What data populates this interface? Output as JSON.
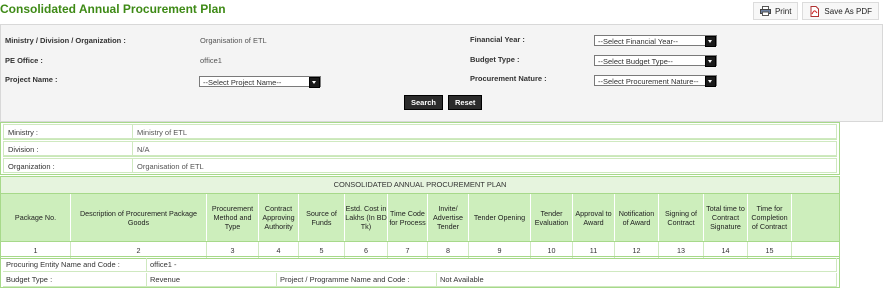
{
  "page": {
    "title": "Consolidated Annual Procurement Plan"
  },
  "actions": {
    "print": "Print",
    "save_pdf": "Save As PDF"
  },
  "filters": {
    "ministry_label": "Ministry / Division / Organization :",
    "ministry_value": "Organisation of ETL",
    "pe_office_label": "PE Office :",
    "pe_office_value": "office1",
    "project_label": "Project Name :",
    "project_select": "--Select Project Name--",
    "fy_label": "Financial Year :",
    "fy_select": "--Select Financial Year--",
    "budget_label": "Budget Type :",
    "budget_select": "--Select Budget Type--",
    "nature_label": "Procurement Nature :",
    "nature_select": "--Select Procurement Nature--",
    "search": "Search",
    "reset": "Reset"
  },
  "info": {
    "rows": [
      {
        "label": "Ministry :",
        "value": "Ministry of ETL"
      },
      {
        "label": "Division :",
        "value": "N/A"
      },
      {
        "label": "Organization :",
        "value": "Organisation of ETL"
      }
    ]
  },
  "plan": {
    "title": "CONSOLIDATED ANNUAL PROCUREMENT PLAN",
    "headers": [
      "Package No.",
      "Description of Procurement Package Goods",
      "Procurement Method and Type",
      "Contract Approving Authority",
      "Source of Funds",
      "Estd. Cost in Lakhs (In BD Tk)",
      "Time Code for Process",
      "Invite/ Advertise Tender",
      "Tender Opening",
      "Tender Evaluation",
      "Approval to Award",
      "Notification of Award",
      "Signing of Contract",
      "Total time to Contract Signature",
      "Time for Completion of Contract"
    ],
    "numbers": [
      "1",
      "2",
      "3",
      "4",
      "5",
      "6",
      "7",
      "8",
      "9",
      "10",
      "11",
      "12",
      "13",
      "14",
      "15"
    ]
  },
  "pe": {
    "entity_label": "Procuring Entity Name and Code :",
    "entity_value": "office1 -",
    "budget_label": "Budget Type :",
    "budget_value": "Revenue",
    "project_label": "Project / Programme Name and Code :",
    "project_value": "Not Available"
  }
}
